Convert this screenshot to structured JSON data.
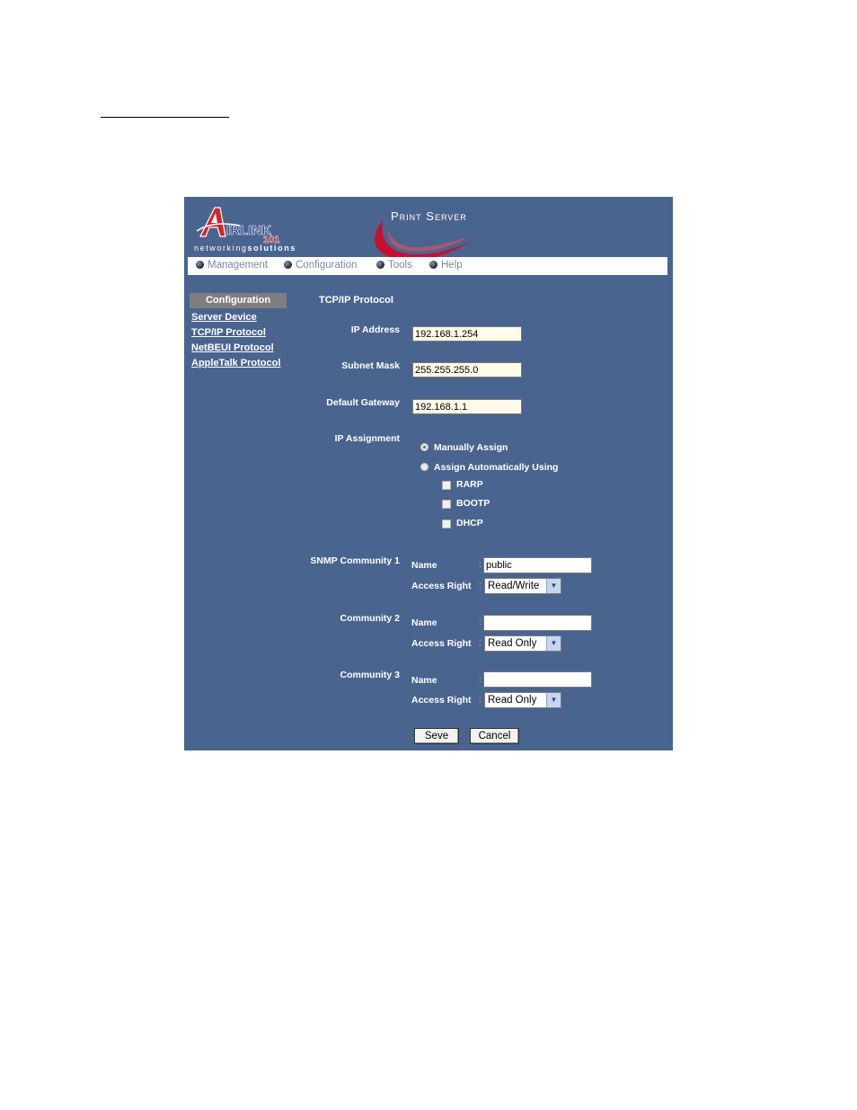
{
  "header": {
    "logo_text": "AIRLINK 101",
    "logo_tagline_a": "networking",
    "logo_tagline_b": "solutions",
    "product_title": "Print Server"
  },
  "nav": [
    {
      "label": "Management"
    },
    {
      "label": "Configuration"
    },
    {
      "label": "Tools"
    },
    {
      "label": "Help"
    }
  ],
  "sidebar": {
    "heading": "Configuration",
    "items": [
      {
        "label": "Server Device"
      },
      {
        "label": "TCP/IP Protocol"
      },
      {
        "label": "NetBEUI Protocol"
      },
      {
        "label": "AppleTalk Protocol"
      }
    ]
  },
  "form": {
    "section_title": "TCP/IP Protocol",
    "ip_address_label": "IP Address",
    "ip_address_value": "192.168.1.254",
    "subnet_mask_label": "Subnet Mask",
    "subnet_mask_value": "255.255.255.0",
    "gateway_label": "Default Gateway",
    "gateway_value": "192.168.1.1",
    "ip_assignment_label": "IP Assignment",
    "manual_label": "Manually Assign",
    "auto_label": "Assign Automatically Using",
    "rarp_label": "RARP",
    "bootp_label": "BOOTP",
    "dhcp_label": "DHCP"
  },
  "snmp": [
    {
      "title": "SNMP Community 1",
      "name_label": "Name",
      "name_value": "public",
      "access_label": "Access Right",
      "access_value": "Read/Write"
    },
    {
      "title": "Community 2",
      "name_label": "Name",
      "name_value": "",
      "access_label": "Access Right",
      "access_value": "Read Only"
    },
    {
      "title": "Community 3",
      "name_label": "Name",
      "name_value": "",
      "access_label": "Access Right",
      "access_value": "Read Only"
    }
  ],
  "buttons": {
    "save": "Seve",
    "cancel": "Cancel"
  },
  "colors": {
    "panel_bg": "#4a6490",
    "logo_red": "#d0262e",
    "logo_blue": "#1f3f8f"
  }
}
